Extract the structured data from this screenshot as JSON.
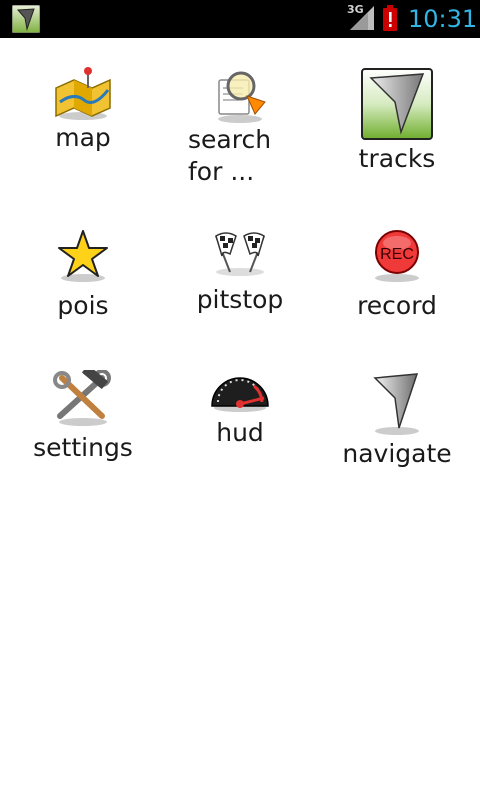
{
  "status_bar": {
    "network_type": "3G",
    "time": "10:31",
    "icons": [
      "app-logo-icon",
      "signal-icon",
      "battery-alert-icon"
    ],
    "time_color": "#33b5e5"
  },
  "menu": {
    "items": [
      {
        "label": "map",
        "icon": "map-icon"
      },
      {
        "label": "search",
        "label2": "for ...",
        "icon": "search-icon"
      },
      {
        "label": "tracks",
        "icon": "tracks-icon"
      },
      {
        "label": "pois",
        "icon": "star-icon"
      },
      {
        "label": "pitstop",
        "icon": "checkered-flags-icon"
      },
      {
        "label": "record",
        "icon": "record-icon"
      },
      {
        "label": "settings",
        "icon": "tools-icon"
      },
      {
        "label": "hud",
        "icon": "speedometer-icon"
      },
      {
        "label": "navigate",
        "icon": "navigate-arrow-icon"
      }
    ]
  }
}
